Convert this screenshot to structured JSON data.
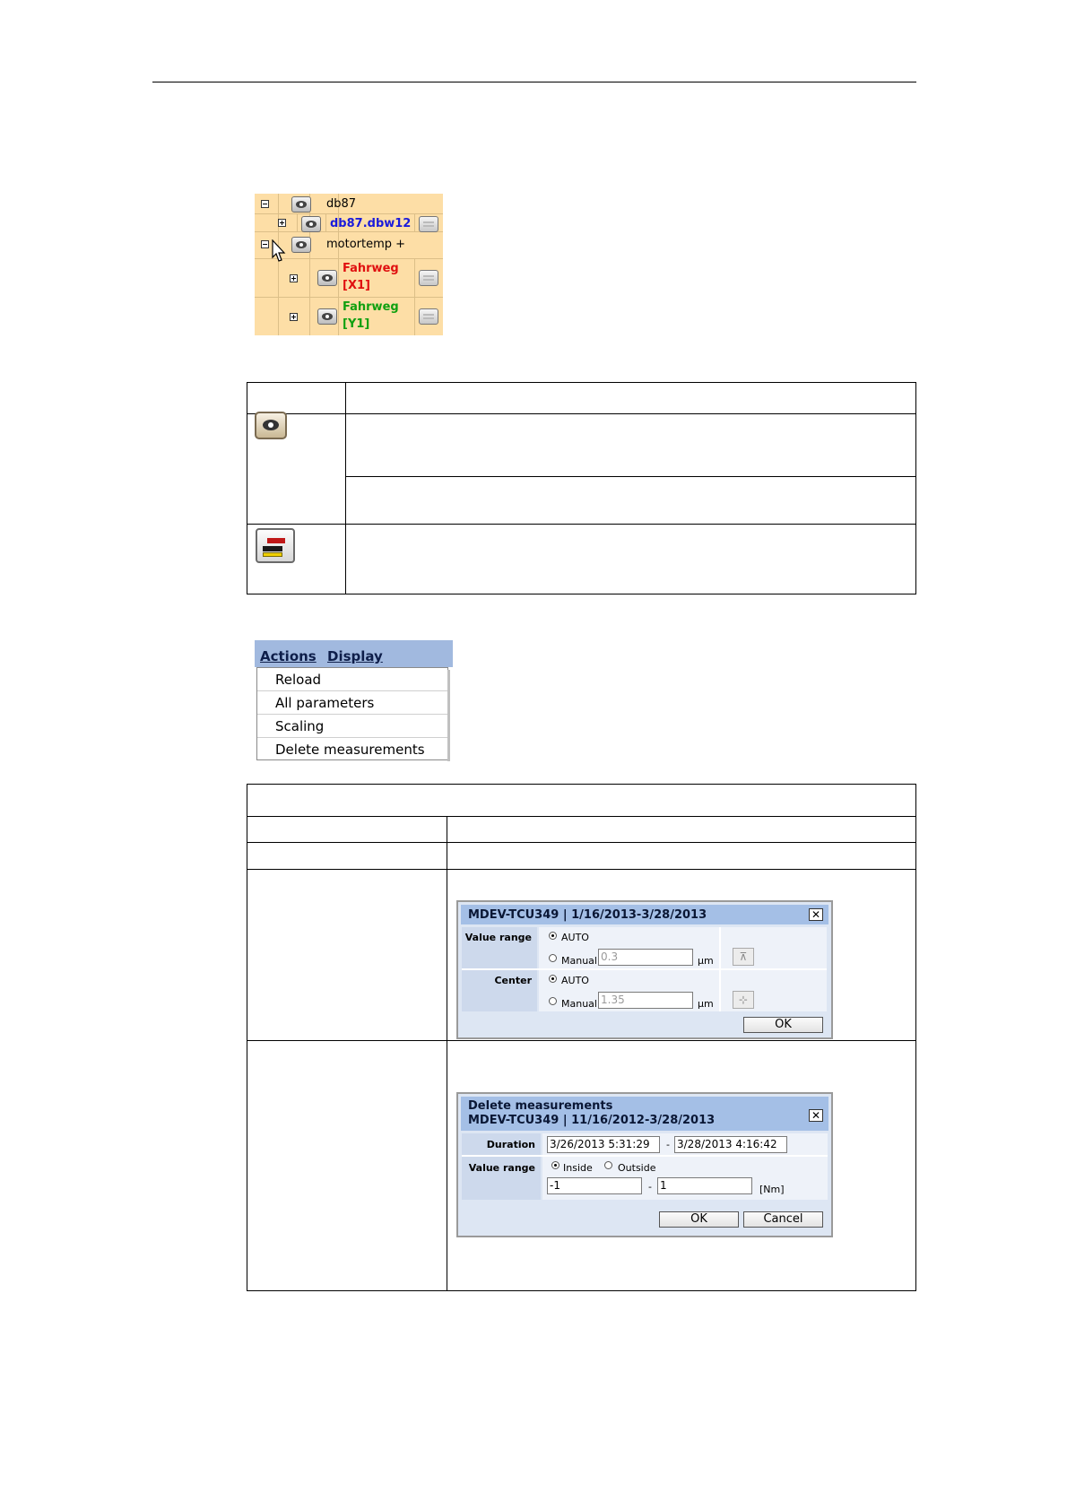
{
  "tree": {
    "rows": [
      {
        "label": "db87",
        "color": "#000000"
      },
      {
        "label": "db87.dbw12",
        "color": "#1a1adb"
      },
      {
        "label": "motortemp +",
        "color": "#000000"
      },
      {
        "label_line1": "Fahrweg",
        "label_line2": "[X1]",
        "color": "#e01010"
      },
      {
        "label_line1": "Fahrweg",
        "label_line2": "[Y1]",
        "color": "#10a010"
      }
    ]
  },
  "icons": {
    "eye": "eye-icon",
    "scaling": "scaling-icon",
    "cursor": "mouse-pointer-icon"
  },
  "menu": {
    "tabs": [
      "Actions",
      "Display"
    ],
    "items": [
      "Reload",
      "All parameters",
      "Scaling",
      "Delete measurements"
    ]
  },
  "scaling_dialog": {
    "title": "MDEV-TCU349 | 1/16/2013-3/28/2013",
    "close": "✕",
    "value_range_label": "Value range",
    "center_label": "Center",
    "auto_label": "AUTO",
    "manual_label": "Manual",
    "value_range_manual": "0.3",
    "center_manual": "1.35",
    "unit": "µm",
    "ok": "OK"
  },
  "delete_dialog": {
    "title_line1": "Delete measurements",
    "title_line2": "MDEV-TCU349 | 11/16/2012-3/28/2013",
    "close": "✕",
    "duration_label": "Duration",
    "duration_from": "3/26/2013 5:31:29",
    "duration_to": "3/28/2013 4:16:42",
    "value_range_label": "Value range",
    "inside_label": "Inside",
    "outside_label": "Outside",
    "range_from": "-1",
    "range_to": "1",
    "unit": "[Nm]",
    "dash": "-",
    "ok": "OK",
    "cancel": "Cancel"
  }
}
